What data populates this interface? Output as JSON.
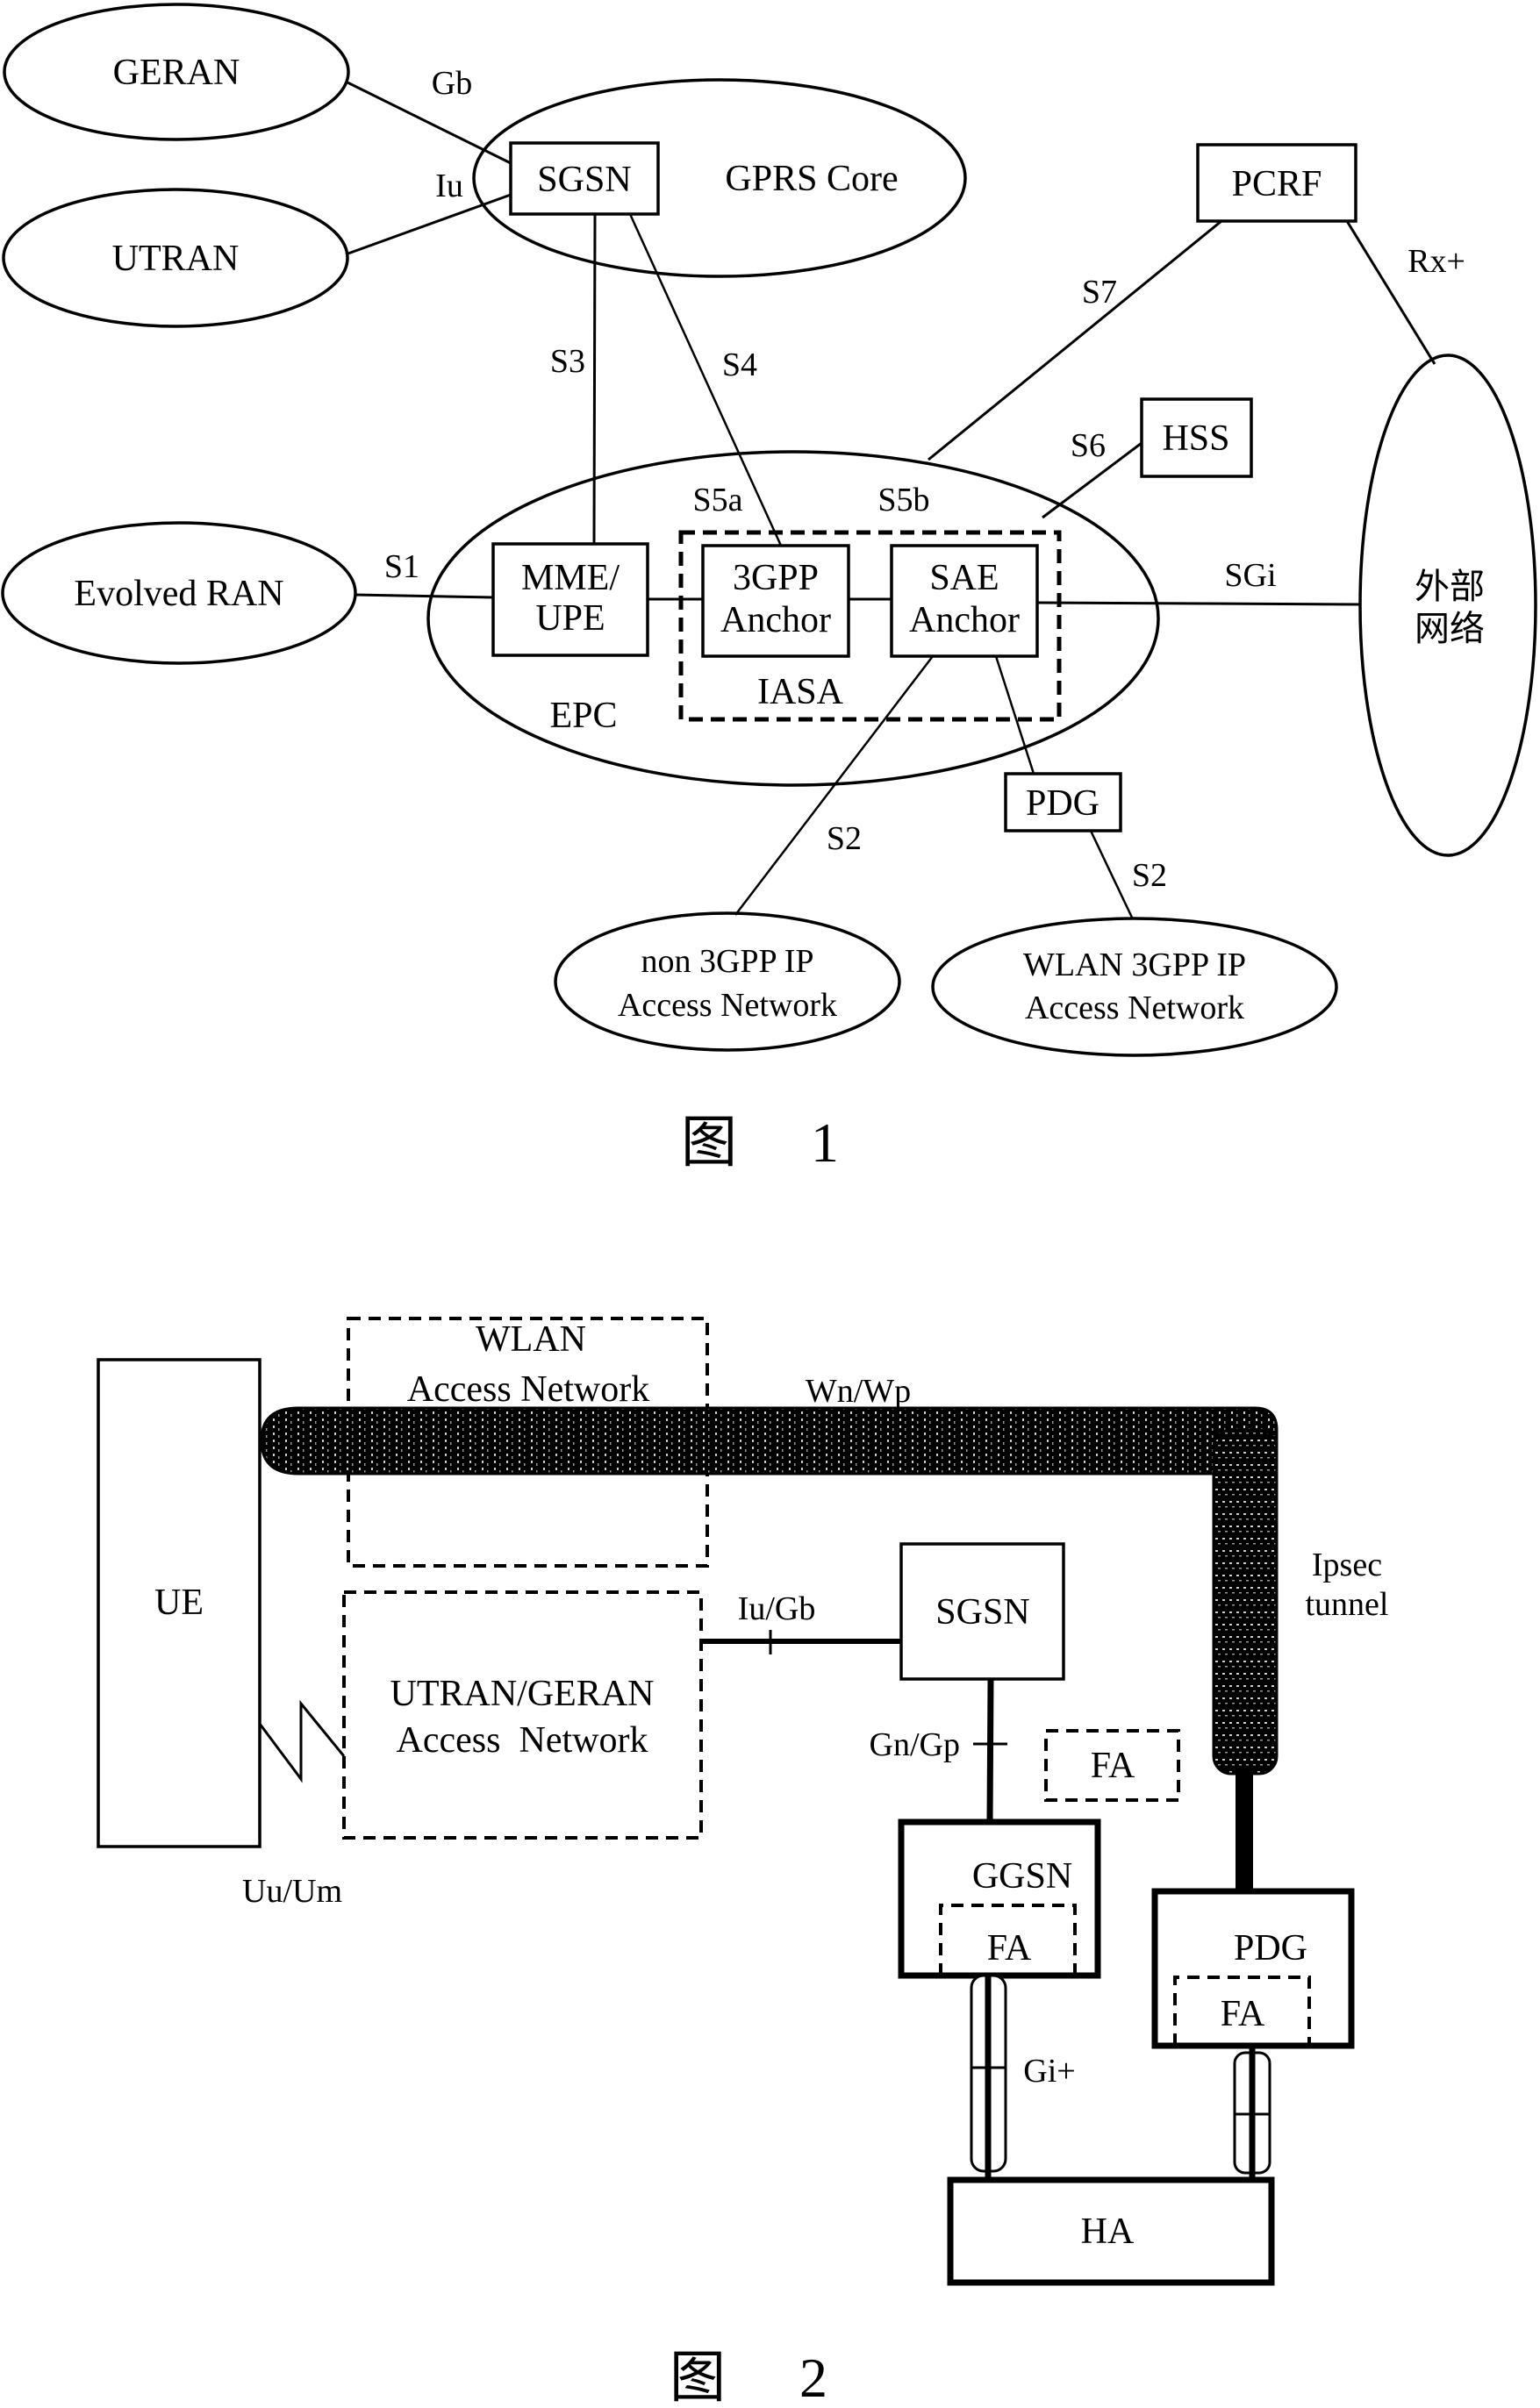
{
  "figure1": {
    "nodes": {
      "geran": "GERAN",
      "utran": "UTRAN",
      "gprs_core": "GPRS Core",
      "sgsn": "SGSN",
      "pcrf": "PCRF",
      "hss": "HSS",
      "evolved_ran": "Evolved RAN",
      "mme_upe_line1": "MME/",
      "mme_upe_line2": "UPE",
      "anchor_3gpp_line1": "3GPP",
      "anchor_3gpp_line2": "Anchor",
      "sae_anchor_line1": "SAE",
      "sae_anchor_line2": "Anchor",
      "iasa": "IASA",
      "epc": "EPC",
      "pdg": "PDG",
      "external_network_line1": "外部",
      "external_network_line2": "网络",
      "non3gpp_line1": "non 3GPP IP",
      "non3gpp_line2": "Access Network",
      "wlan3gpp_line1": "WLAN 3GPP IP",
      "wlan3gpp_line2": "Access Network"
    },
    "interfaces": {
      "gb": "Gb",
      "iu": "Iu",
      "s3": "S3",
      "s4": "S4",
      "s7": "S7",
      "rx_plus": "Rx+",
      "s6": "S6",
      "s5a": "S5a",
      "s5b": "S5b",
      "s1": "S1",
      "sgi": "SGi",
      "s2_left": "S2",
      "s2_right": "S2"
    },
    "caption_prefix": "图",
    "caption_number": "1"
  },
  "figure2": {
    "nodes": {
      "ue": "UE",
      "wlan_line1": "WLAN",
      "wlan_line2": "Access Network",
      "utran_geran_line1": "UTRAN/GERAN",
      "utran_geran_line2": "Access  Network",
      "sgsn": "SGSN",
      "fa_standalone": "FA",
      "ggsn": "GGSN",
      "ggsn_fa": "FA",
      "pdg": "PDG",
      "pdg_fa": "FA",
      "ha": "HA"
    },
    "interfaces": {
      "wn_wp": "Wn/Wp",
      "iu_gb": "Iu/Gb",
      "gn_gp": "Gn/Gp",
      "uu_um": "Uu/Um",
      "gi_plus": "Gi+",
      "ipsec_line1": "Ipsec",
      "ipsec_line2": "tunnel"
    },
    "caption_prefix": "图",
    "caption_number": "2"
  }
}
